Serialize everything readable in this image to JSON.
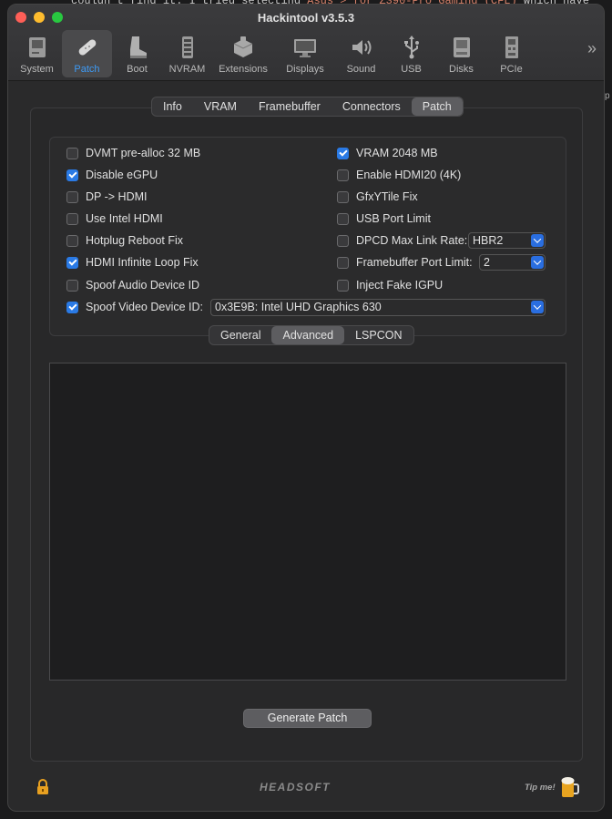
{
  "background": {
    "line_start": "couldn't find it. I tried selecting ",
    "line_highlight": "Asus > for Z390-Pro Gaming (CFL)",
    "line_end": " which have",
    "side_text": "p"
  },
  "window": {
    "title": "Hackintool v3.5.3"
  },
  "toolbar": {
    "items": [
      {
        "label": "System",
        "icon": "system-icon"
      },
      {
        "label": "Patch",
        "icon": "patch-icon",
        "active": true
      },
      {
        "label": "Boot",
        "icon": "boot-icon"
      },
      {
        "label": "NVRAM",
        "icon": "nvram-icon"
      },
      {
        "label": "Extensions",
        "icon": "extensions-icon"
      },
      {
        "label": "Displays",
        "icon": "displays-icon"
      },
      {
        "label": "Sound",
        "icon": "sound-icon"
      },
      {
        "label": "USB",
        "icon": "usb-icon"
      },
      {
        "label": "Disks",
        "icon": "disks-icon"
      },
      {
        "label": "PCIe",
        "icon": "pcie-icon"
      }
    ],
    "overflow": "»"
  },
  "tabs": [
    "Info",
    "VRAM",
    "Framebuffer",
    "Connectors",
    "Patch"
  ],
  "selected_tab": "Patch",
  "options_left": [
    {
      "label": "DVMT pre-alloc 32 MB",
      "checked": false
    },
    {
      "label": "Disable eGPU",
      "checked": true
    },
    {
      "label": "DP -> HDMI",
      "checked": false
    },
    {
      "label": "Use Intel HDMI",
      "checked": false
    },
    {
      "label": "Hotplug Reboot Fix",
      "checked": false
    },
    {
      "label": "HDMI Infinite Loop Fix",
      "checked": true
    },
    {
      "label": "Spoof Audio Device ID",
      "checked": false
    }
  ],
  "options_right": [
    {
      "label": "VRAM 2048 MB",
      "checked": true
    },
    {
      "label": "Enable HDMI20 (4K)",
      "checked": false
    },
    {
      "label": "GfxYTile Fix",
      "checked": false
    },
    {
      "label": "USB Port Limit",
      "checked": false
    },
    {
      "label": "DPCD Max Link Rate:",
      "checked": false
    },
    {
      "label": "Framebuffer Port Limit:",
      "checked": false
    },
    {
      "label": "Inject Fake IGPU",
      "checked": false
    }
  ],
  "dpcd_value": "HBR2",
  "fb_port_limit_value": "2",
  "spoof_video": {
    "label": "Spoof Video Device ID:",
    "checked": true,
    "value": "0x3E9B: Intel UHD Graphics 630"
  },
  "subtabs": [
    "General",
    "Advanced",
    "LSPCON"
  ],
  "selected_subtab": "Advanced",
  "generate_label": "Generate Patch",
  "footer": {
    "brand": "HEADSOFT",
    "tip": "Tip me!"
  },
  "colors": {
    "accent": "#2a7ae5",
    "active_tab_text": "#3d9af5"
  }
}
